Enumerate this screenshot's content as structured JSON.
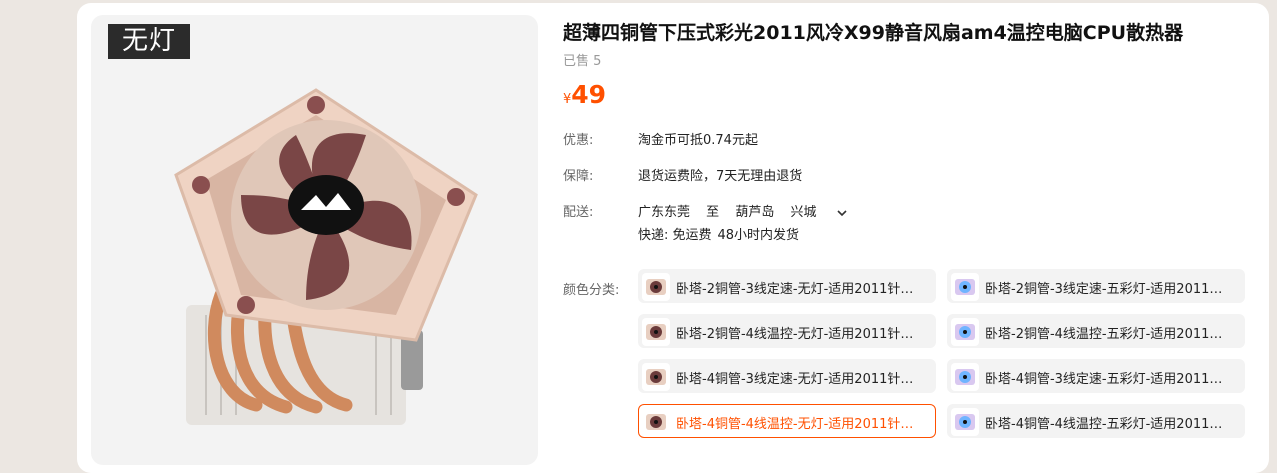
{
  "product": {
    "badge": "无灯",
    "title": "超薄四铜管下压式彩光2011风冷X99静音风扇am4温控电脑CPU散热器",
    "sold": "已售 5",
    "currency": "¥",
    "price": "49"
  },
  "rows": {
    "discount": {
      "label": "优惠:",
      "value": "淘金币可抵0.74元起"
    },
    "guarantee": {
      "label": "保障:",
      "value": "退货运费险，7天无理由退货"
    },
    "delivery": {
      "label": "配送:",
      "from": "广东东莞",
      "to_word": "至",
      "city": "葫芦岛",
      "district": "兴城",
      "express": "快递: 免运费",
      "ship_time": "48小时内发货"
    }
  },
  "sku": {
    "label": "颜色分类:",
    "options": [
      {
        "text": "卧塔-2铜管-3线定速-无灯-适用2011针…",
        "icon": "cooler-thumb-icon",
        "selected": false
      },
      {
        "text": "卧塔-2铜管-3线定速-五彩灯-适用2011…",
        "icon": "rgb-cooler-thumb-icon",
        "selected": false
      },
      {
        "text": "卧塔-2铜管-4线温控-无灯-适用2011针…",
        "icon": "cooler-thumb-icon",
        "selected": false
      },
      {
        "text": "卧塔-2铜管-4线温控-五彩灯-适用2011…",
        "icon": "rgb-cooler-thumb-icon",
        "selected": false
      },
      {
        "text": "卧塔-4铜管-3线定速-无灯-适用2011针…",
        "icon": "cooler-thumb-icon",
        "selected": false
      },
      {
        "text": "卧塔-4铜管-3线定速-五彩灯-适用2011…",
        "icon": "rgb-cooler-thumb-icon",
        "selected": false
      },
      {
        "text": "卧塔-4铜管-4线温控-无灯-适用2011针…",
        "icon": "cooler-thumb-icon",
        "selected": true
      },
      {
        "text": "卧塔-4铜管-4线温控-五彩灯-适用2011…",
        "icon": "rgb-cooler-thumb-icon",
        "selected": false
      }
    ]
  },
  "colors": {
    "accent": "#ff5000",
    "muted": "#999999",
    "chip_bg": "#f3f3f3"
  }
}
